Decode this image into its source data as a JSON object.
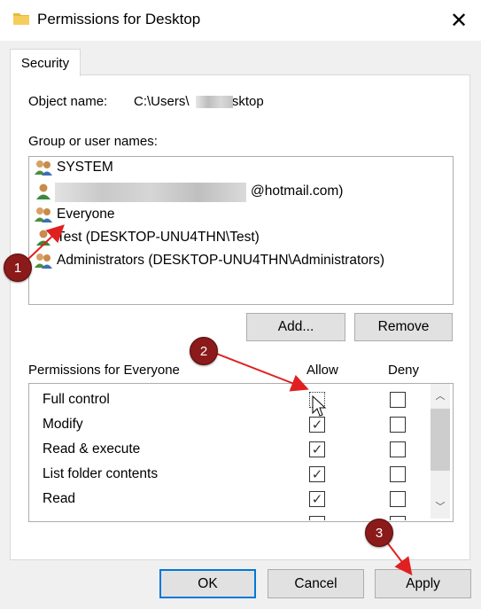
{
  "window": {
    "title": "Permissions for Desktop",
    "close_icon": "close-icon"
  },
  "tabs": [
    {
      "label": "Security"
    }
  ],
  "object": {
    "label": "Object name:",
    "value": "C:\\Users\\      \\Desktop"
  },
  "group": {
    "label": "Group or user names:",
    "users": [
      {
        "name": "SYSTEM",
        "icon": "group-users-icon"
      },
      {
        "name": "@hotmail.com)",
        "icon": "user-icon"
      },
      {
        "name": "Everyone",
        "icon": "group-users-icon"
      },
      {
        "name": "Test (DESKTOP-UNU4THN\\Test)",
        "icon": "user-icon"
      },
      {
        "name": "Administrators (DESKTOP-UNU4THN\\Administrators)",
        "icon": "group-users-icon"
      }
    ]
  },
  "buttons": {
    "add": "Add...",
    "remove": "Remove",
    "ok": "OK",
    "cancel": "Cancel",
    "apply": "Apply"
  },
  "permissions": {
    "label": "Permissions for Everyone",
    "allow_header": "Allow",
    "deny_header": "Deny",
    "rows": [
      {
        "name": "Full control",
        "allow": false,
        "deny": false
      },
      {
        "name": "Modify",
        "allow": true,
        "deny": false
      },
      {
        "name": "Read & execute",
        "allow": true,
        "deny": false
      },
      {
        "name": "List folder contents",
        "allow": true,
        "deny": false
      },
      {
        "name": "Read",
        "allow": true,
        "deny": false
      }
    ]
  },
  "annotations": [
    {
      "number": "1"
    },
    {
      "number": "2"
    },
    {
      "number": "3"
    }
  ],
  "colors": {
    "annotation": "#8b1a1a",
    "arrow": "#e02020",
    "focus": "#0078d7"
  }
}
